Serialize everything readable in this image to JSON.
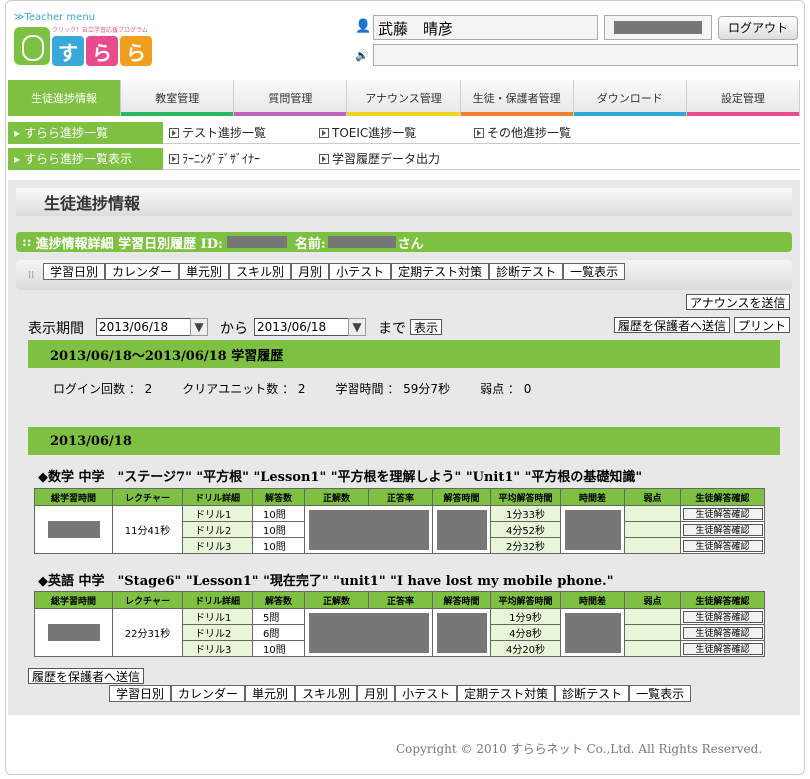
{
  "header": {
    "teacher_menu": "≫Teacher menu",
    "logo_sub": "クリック！自立学習応援プログラム",
    "logo_tiles": [
      {
        "char": "す",
        "color": "#3aa8d8"
      },
      {
        "char": "ら",
        "color": "#e84c8c"
      },
      {
        "char": "ら",
        "color": "#f0a020"
      }
    ],
    "user_name": "武藤　晴彦",
    "logout_label": "ログアウト"
  },
  "nav": [
    {
      "label": "生徒進捗情報",
      "color": "#7ec142",
      "active": true
    },
    {
      "label": "教室管理",
      "color": "#2ab860"
    },
    {
      "label": "質問管理",
      "color": "#c060c0"
    },
    {
      "label": "アナウンス管理",
      "color": "#f0d020"
    },
    {
      "label": "生徒・保護者管理",
      "color": "#f08030"
    },
    {
      "label": "ダウンロード",
      "color": "#30a8d8"
    },
    {
      "label": "設定管理",
      "color": "#e84c8c"
    }
  ],
  "subnav1": {
    "active": "すらら進捗一覧",
    "links": [
      "テスト進捗一覧",
      "TOEIC進捗一覧",
      "その他進捗一覧"
    ]
  },
  "subnav2": {
    "active": "すらら進捗一覧表示",
    "links": [
      "ﾗｰﾆﾝｸﾞﾃﾞｻﾞｲﾅｰ",
      "学習履歴データ出力"
    ]
  },
  "page_title": "生徒進捗情報",
  "info_bar": {
    "prefix": "進捗情報詳細 学習日別履歴 ID:",
    "name_label": "名前:",
    "suffix": "さん"
  },
  "tabs": [
    "学習日別",
    "カレンダー",
    "単元別",
    "スキル別",
    "月別",
    "小テスト",
    "定期テスト対策",
    "診断テスト",
    "一覧表示"
  ],
  "buttons": {
    "announce": "アナウンスを送信",
    "send_parent": "履歴を保護者へ送信",
    "print": "プリント",
    "show": "表示",
    "send_parent_bottom": "履歴を保護者へ送信"
  },
  "period": {
    "label": "表示期間",
    "from": "2013/06/18",
    "from_word": "から",
    "to": "2013/06/18",
    "to_word": "まで"
  },
  "history_title": "2013/06/18～2013/06/18 学習履歴",
  "stats": [
    "ログイン回数 ： 2",
    "クリアユニット数 ： 2",
    "学習時間 ： 59分7秒",
    "弱点 ： 0"
  ],
  "date_bar": "2013/06/18",
  "table_headers": [
    "総学習時間",
    "レクチャー",
    "ドリル詳細",
    "解答数",
    "正解数",
    "正答率",
    "解答時間",
    "平均解答時間",
    "時間差",
    "弱点",
    "生徒解答確認"
  ],
  "confirm_label": "生徒解答確認",
  "subjects": [
    {
      "title": "◆数学 中学　\"ステージ7\" \"平方根\" \"Lesson1\" \"平方根を理解しよう\" \"Unit1\" \"平方根の基礎知識\"",
      "lecture": "11分41秒",
      "drills": [
        {
          "name": "ドリル1",
          "count": "10問",
          "avg": "1分33秒"
        },
        {
          "name": "ドリル2",
          "count": "10問",
          "avg": "4分52秒"
        },
        {
          "name": "ドリル3",
          "count": "10問",
          "avg": "2分32秒"
        }
      ]
    },
    {
      "title": "◆英語 中学　\"Stage6\" \"Lesson1\" \"現在完了\" \"unit1\" \"I have lost my mobile phone.\"",
      "lecture": "22分31秒",
      "drills": [
        {
          "name": "ドリル1",
          "count": "5問",
          "avg": "1分9秒"
        },
        {
          "name": "ドリル2",
          "count": "6問",
          "avg": "4分8秒"
        },
        {
          "name": "ドリル3",
          "count": "10問",
          "avg": "4分20秒"
        }
      ]
    }
  ],
  "footer": "Copyright © 2010 すららネット Co.,Ltd. All Rights Reserved."
}
